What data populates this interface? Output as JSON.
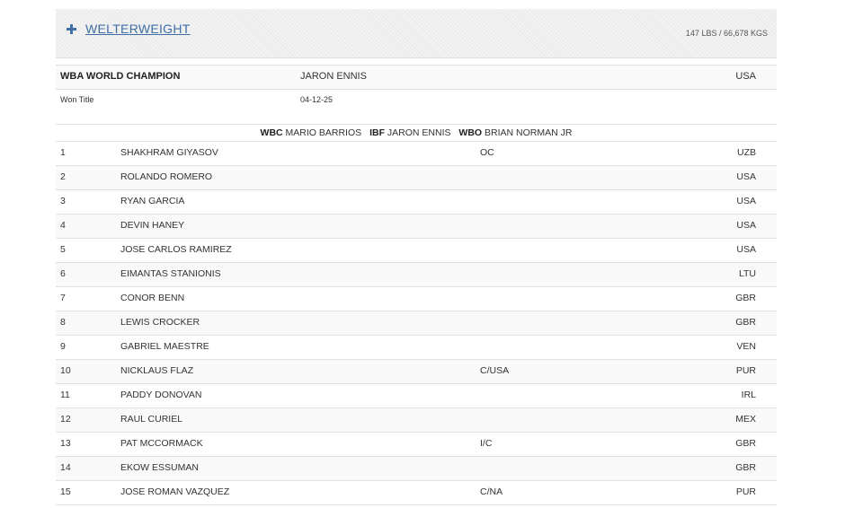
{
  "division": {
    "name": "WELTERWEIGHT",
    "weight": "147 LBS / 66,678 KGS"
  },
  "champion": {
    "label": "WBA WORLD CHAMPION",
    "name": "JARON ENNIS",
    "country": "USA",
    "won_title_label": "Won Title",
    "won_title_date": "04-12-25"
  },
  "other_champions": [
    {
      "org": "WBC",
      "name": "MARIO BARRIOS"
    },
    {
      "org": "IBF",
      "name": "JARON ENNIS"
    },
    {
      "org": "WBO",
      "name": "BRIAN NORMAN JR"
    }
  ],
  "rankings": [
    {
      "rank": "1",
      "name": "SHAKHRAM GIYASOV",
      "status": "OC",
      "country": "UZB"
    },
    {
      "rank": "2",
      "name": "ROLANDO ROMERO",
      "status": "",
      "country": "USA"
    },
    {
      "rank": "3",
      "name": "RYAN GARCIA",
      "status": "",
      "country": "USA"
    },
    {
      "rank": "4",
      "name": "DEVIN HANEY",
      "status": "",
      "country": "USA"
    },
    {
      "rank": "5",
      "name": "JOSE CARLOS RAMIREZ",
      "status": "",
      "country": "USA"
    },
    {
      "rank": "6",
      "name": "EIMANTAS STANIONIS",
      "status": "",
      "country": "LTU"
    },
    {
      "rank": "7",
      "name": "CONOR BENN",
      "status": "",
      "country": "GBR"
    },
    {
      "rank": "8",
      "name": "LEWIS CROCKER",
      "status": "",
      "country": "GBR"
    },
    {
      "rank": "9",
      "name": "GABRIEL MAESTRE",
      "status": "",
      "country": "VEN"
    },
    {
      "rank": "10",
      "name": "NICKLAUS FLAZ",
      "status": "C/USA",
      "country": "PUR"
    },
    {
      "rank": "11",
      "name": "PADDY DONOVAN",
      "status": "",
      "country": "IRL"
    },
    {
      "rank": "12",
      "name": "RAUL CURIEL",
      "status": "",
      "country": "MEX"
    },
    {
      "rank": "13",
      "name": "PAT MCCORMACK",
      "status": "I/C",
      "country": "GBR"
    },
    {
      "rank": "14",
      "name": "EKOW ESSUMAN",
      "status": "",
      "country": "GBR"
    },
    {
      "rank": "15",
      "name": "JOSE ROMAN VAZQUEZ",
      "status": "C/NA",
      "country": "PUR"
    }
  ]
}
